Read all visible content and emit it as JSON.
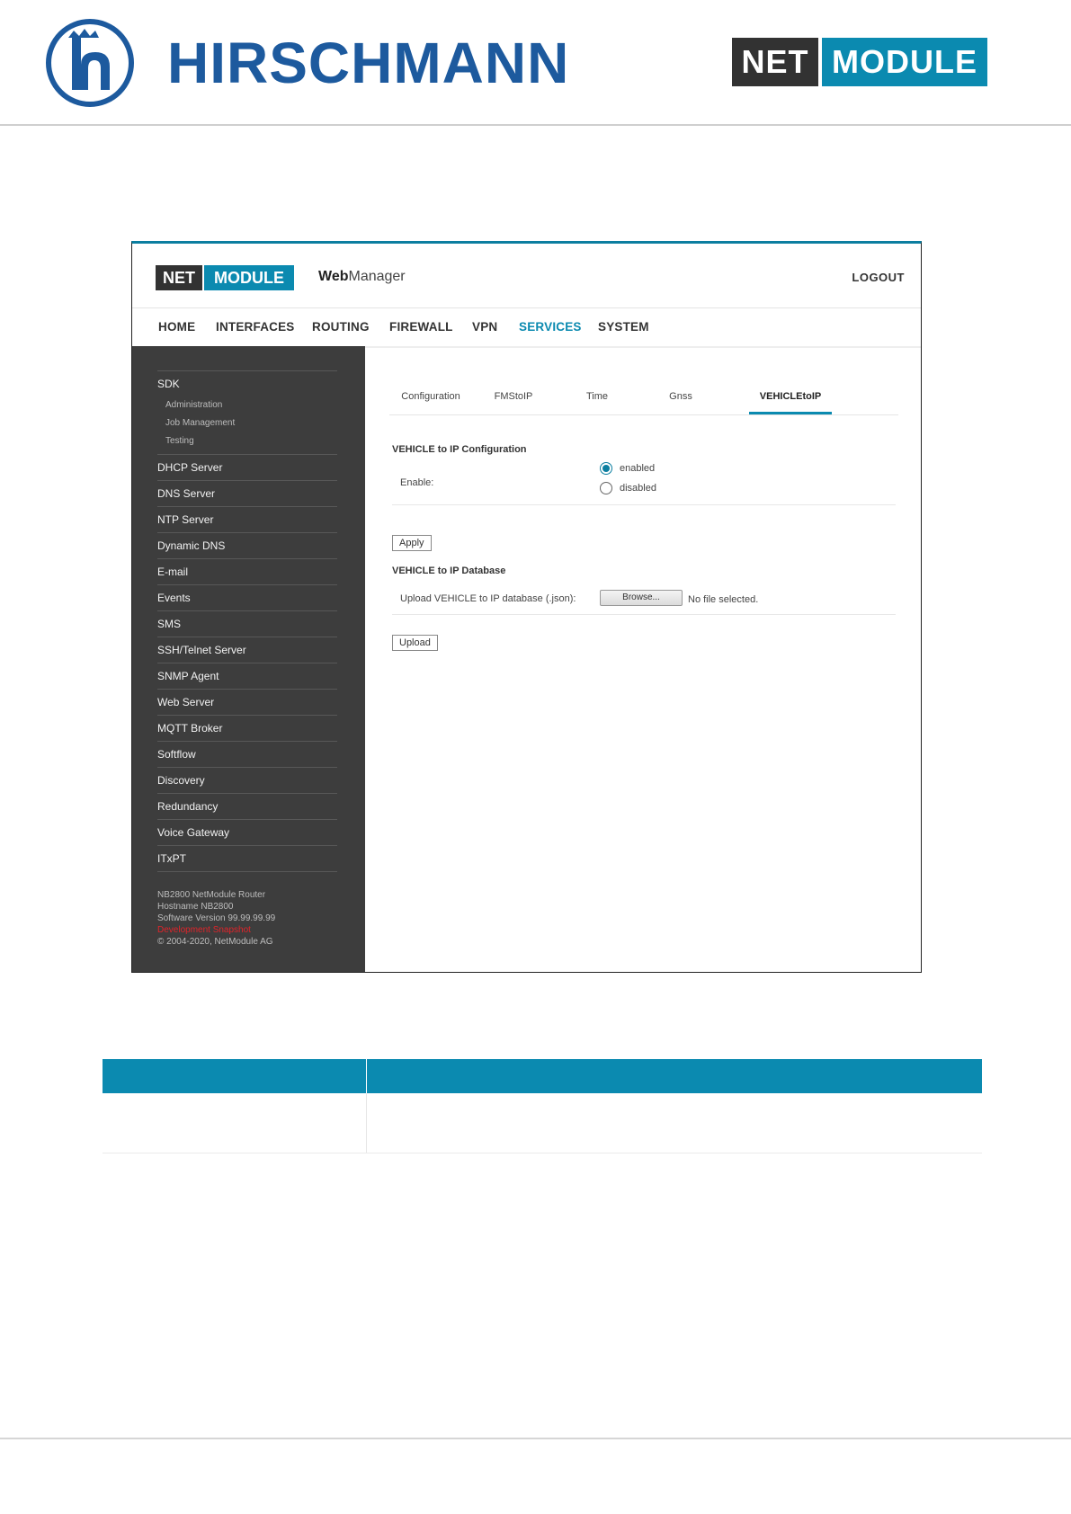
{
  "page_header": {
    "brand_left": "HIRSCHMANN",
    "brand_right_net": "NET",
    "brand_right_module": "MODULE"
  },
  "webmanager": {
    "logo_net": "NET",
    "logo_module": "MODULE",
    "title_bold": "Web",
    "title_rest": "Manager",
    "logout": "LOGOUT",
    "accent_color": "#0b8ab0",
    "nav": [
      {
        "label": "HOME",
        "active": false
      },
      {
        "label": "INTERFACES",
        "active": false
      },
      {
        "label": "ROUTING",
        "active": false
      },
      {
        "label": "FIREWALL",
        "active": false
      },
      {
        "label": "VPN",
        "active": false
      },
      {
        "label": "SERVICES",
        "active": true
      },
      {
        "label": "SYSTEM",
        "active": false
      }
    ],
    "sidebar": {
      "sdk": "SDK",
      "sdk_sub": [
        "Administration",
        "Job Management",
        "Testing"
      ],
      "items": [
        "DHCP Server",
        "DNS Server",
        "NTP Server",
        "Dynamic DNS",
        "E-mail",
        "Events",
        "SMS",
        "SSH/Telnet Server",
        "SNMP Agent",
        "Web Server",
        "MQTT Broker",
        "Softflow",
        "Discovery",
        "Redundancy",
        "Voice Gateway",
        "ITxPT"
      ],
      "info": {
        "line1": "NB2800 NetModule Router",
        "line2": "Hostname NB2800",
        "line3": "Software Version 99.99.99.99",
        "line4_red": "Development Snapshot",
        "line5": "© 2004-2020, NetModule AG"
      }
    },
    "tabs": [
      {
        "label": "Configuration",
        "active": false
      },
      {
        "label": "FMStoIP",
        "active": false
      },
      {
        "label": "Time",
        "active": false
      },
      {
        "label": "Gnss",
        "active": false
      },
      {
        "label": "VEHICLEtoIP",
        "active": true
      }
    ],
    "config": {
      "title": "VEHICLE to IP Configuration",
      "enable_label": "Enable:",
      "opt_enabled": "enabled",
      "opt_disabled": "disabled",
      "selected": "enabled",
      "apply": "Apply"
    },
    "database": {
      "title": "VEHICLE to IP Database",
      "upload_label": "Upload VEHICLE to IP database (.json):",
      "browse": "Browse...",
      "no_file": "No file selected.",
      "upload": "Upload"
    }
  }
}
